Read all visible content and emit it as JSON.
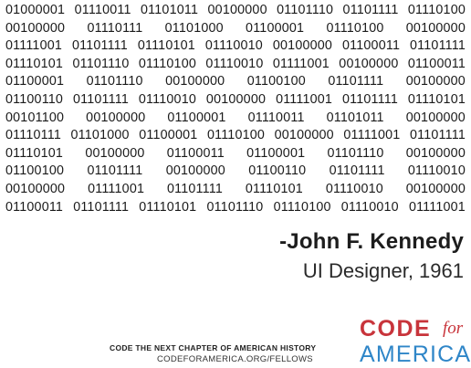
{
  "binary_lines": [
    [
      "01000001",
      "01110011",
      "01101011",
      "00100000",
      "01101110",
      "01101111",
      "01110100"
    ],
    [
      "00100000",
      "01110111",
      "01101000",
      "01100001",
      "01110100",
      "00100000"
    ],
    [
      "01111001",
      "01101111",
      "01110101",
      "01110010",
      "00100000",
      "01100011",
      "01101111"
    ],
    [
      "01110101",
      "01101110",
      "01110100",
      "01110010",
      "01111001",
      "00100000",
      "01100011"
    ],
    [
      "01100001",
      "01101110",
      "00100000",
      "01100100",
      "01101111",
      "00100000"
    ],
    [
      "01100110",
      "01101111",
      "01110010",
      "00100000",
      "01111001",
      "01101111",
      "01110101"
    ],
    [
      "00101100",
      "00100000",
      "01100001",
      "01110011",
      "01101011",
      "00100000"
    ],
    [
      "01110111",
      "01101000",
      "01100001",
      "01110100",
      "00100000",
      "01111001",
      "01101111"
    ],
    [
      "01110101",
      "00100000",
      "01100011",
      "01100001",
      "01101110",
      "00100000"
    ],
    [
      "01100100",
      "01101111",
      "00100000",
      "01100110",
      "01101111",
      "01110010"
    ],
    [
      "00100000",
      "01111001",
      "01101111",
      "01110101",
      "01110010",
      "00100000"
    ],
    [
      "01100011",
      "01101111",
      "01110101",
      "01101110",
      "01110100",
      "01110010",
      "01111001"
    ]
  ],
  "quote": {
    "author": "-John F. Kennedy",
    "role": "UI Designer, 1961"
  },
  "footer": {
    "tagline": "CODE THE NEXT CHAPTER OF AMERICAN HISTORY",
    "url": "CODEFORAMERICA.ORG/FELLOWS"
  },
  "logo": {
    "code": "CODE",
    "for": "for",
    "america": "AMERICA",
    "colors": {
      "red": "#c8343b",
      "blue": "#2f86c8"
    }
  }
}
